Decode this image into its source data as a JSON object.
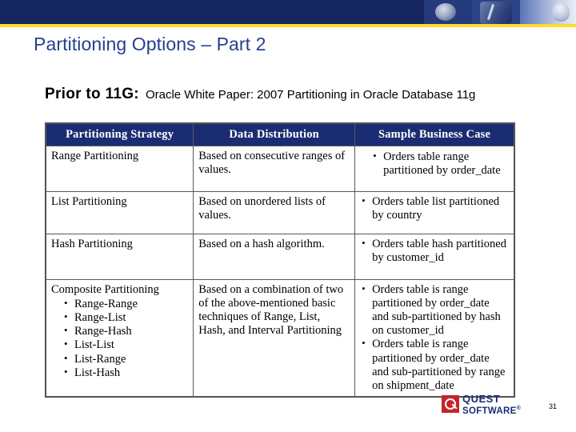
{
  "slide": {
    "title": "Partitioning Options – Part 2",
    "subtitle_strong": "Prior to 11G:",
    "subtitle_rest": "Oracle White Paper: 2007 Partitioning in Oracle Database 11g",
    "slide_number": "31",
    "accent_color": "#1b2d72",
    "rule_color": "#ffd92e",
    "title_color": "#24408f"
  },
  "table": {
    "headers": [
      "Partitioning Strategy",
      "Data Distribution",
      "Sample Business Case"
    ],
    "rows": [
      {
        "strategy": "Range Partitioning",
        "distribution": "Based on consecutive ranges of values.",
        "business_case": [
          "Orders table range partitioned by order_date"
        ]
      },
      {
        "strategy": "List Partitioning",
        "distribution": "Based on unordered lists of values.",
        "business_case": [
          "Orders table  list partitioned by country"
        ]
      },
      {
        "strategy": "Hash Partitioning",
        "distribution": "Based on a hash algorithm.",
        "business_case": [
          "Orders table hash partitioned by customer_id"
        ]
      },
      {
        "strategy": "Composite Partitioning",
        "strategy_bullets": [
          "Range-Range",
          "Range-List",
          "Range-Hash",
          "List-List",
          "List-Range",
          "List-Hash"
        ],
        "distribution": "Based on a combination of two of the above-mentioned basic techniques of Range, List, Hash, and Interval Partitioning",
        "business_case": [
          "Orders table is range partitioned by order_date and sub-partitioned by hash on customer_id",
          "Orders table is range partitioned by order_date and sub-partitioned by range on shipment_date"
        ]
      }
    ]
  },
  "footer": {
    "logo_line1": "QUEST",
    "logo_line2": "SOFTWARE",
    "logo_registered": "®"
  }
}
